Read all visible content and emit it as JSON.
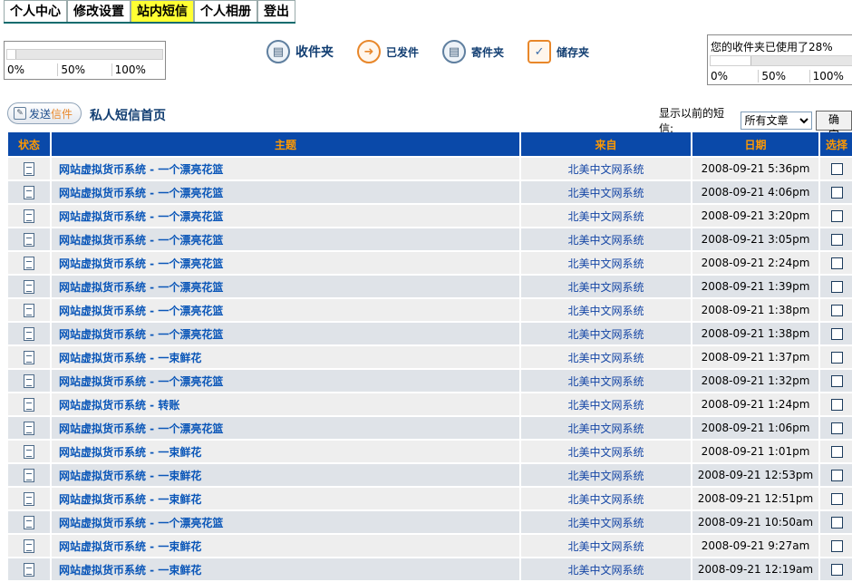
{
  "tabs": [
    {
      "label": "个人中心"
    },
    {
      "label": "修改设置"
    },
    {
      "label": "站内短信",
      "active": true
    },
    {
      "label": "个人相册"
    },
    {
      "label": "登出"
    }
  ],
  "quota_left": {
    "scale": [
      "0%",
      "50%",
      "100%"
    ],
    "used_fraction": 0.0
  },
  "quota_right": {
    "text": "您的收件夹已使用了28%",
    "scale": [
      "0%",
      "50%",
      "100%"
    ],
    "used_fraction": 0.28
  },
  "folders": [
    {
      "label": "收件夹",
      "icon": "inbox-icon"
    },
    {
      "label": "已发件",
      "icon": "arrow-right-icon"
    },
    {
      "label": "寄件夹",
      "icon": "outbox-icon"
    },
    {
      "label": "储存夹",
      "icon": "check-icon"
    }
  ],
  "send_button": {
    "part1": "发送",
    "part2": "信件"
  },
  "home_title": "私人短信首页",
  "filter": {
    "label": "显示以前的短信:",
    "selected": "所有文章",
    "ok_label": "确定"
  },
  "table": {
    "headers": [
      "状态",
      "主题",
      "来自",
      "日期",
      "选择"
    ],
    "rows": [
      {
        "subject": "网站虚拟货币系统 - 一个漂亮花篮",
        "from": "北美中文网系统",
        "date": "2008-09-21 5:36pm"
      },
      {
        "subject": "网站虚拟货币系统 - 一个漂亮花篮",
        "from": "北美中文网系统",
        "date": "2008-09-21 4:06pm"
      },
      {
        "subject": "网站虚拟货币系统 - 一个漂亮花篮",
        "from": "北美中文网系统",
        "date": "2008-09-21 3:20pm"
      },
      {
        "subject": "网站虚拟货币系统 - 一个漂亮花篮",
        "from": "北美中文网系统",
        "date": "2008-09-21 3:05pm"
      },
      {
        "subject": "网站虚拟货币系统 - 一个漂亮花篮",
        "from": "北美中文网系统",
        "date": "2008-09-21 2:24pm"
      },
      {
        "subject": "网站虚拟货币系统 - 一个漂亮花篮",
        "from": "北美中文网系统",
        "date": "2008-09-21 1:39pm"
      },
      {
        "subject": "网站虚拟货币系统 - 一个漂亮花篮",
        "from": "北美中文网系统",
        "date": "2008-09-21 1:38pm"
      },
      {
        "subject": "网站虚拟货币系统 - 一个漂亮花篮",
        "from": "北美中文网系统",
        "date": "2008-09-21 1:38pm"
      },
      {
        "subject": "网站虚拟货币系统 - 一束鲜花",
        "from": "北美中文网系统",
        "date": "2008-09-21 1:37pm"
      },
      {
        "subject": "网站虚拟货币系统 - 一个漂亮花篮",
        "from": "北美中文网系统",
        "date": "2008-09-21 1:32pm"
      },
      {
        "subject": "网站虚拟货币系统 - 转账",
        "from": "北美中文网系统",
        "date": "2008-09-21 1:24pm"
      },
      {
        "subject": "网站虚拟货币系统 - 一个漂亮花篮",
        "from": "北美中文网系统",
        "date": "2008-09-21 1:06pm"
      },
      {
        "subject": "网站虚拟货币系统 - 一束鲜花",
        "from": "北美中文网系统",
        "date": "2008-09-21 1:01pm"
      },
      {
        "subject": "网站虚拟货币系统 - 一束鲜花",
        "from": "北美中文网系统",
        "date": "2008-09-21 12:53pm"
      },
      {
        "subject": "网站虚拟货币系统 - 一束鲜花",
        "from": "北美中文网系统",
        "date": "2008-09-21 12:51pm"
      },
      {
        "subject": "网站虚拟货币系统 - 一个漂亮花篮",
        "from": "北美中文网系统",
        "date": "2008-09-21 10:50am"
      },
      {
        "subject": "网站虚拟货币系统 - 一束鲜花",
        "from": "北美中文网系统",
        "date": "2008-09-21 9:27am"
      },
      {
        "subject": "网站虚拟货币系统 - 一束鲜花",
        "from": "北美中文网系统",
        "date": "2008-09-21 12:19am"
      }
    ]
  }
}
